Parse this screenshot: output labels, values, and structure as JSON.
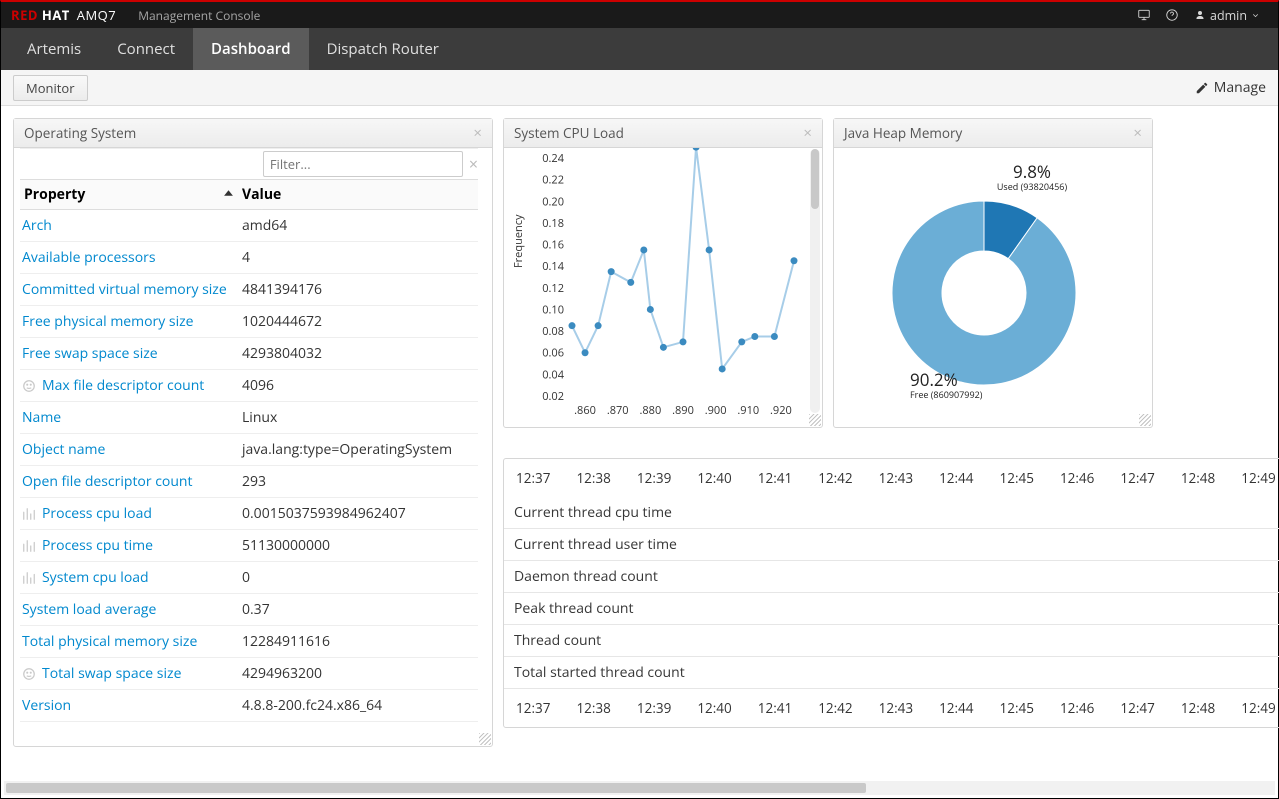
{
  "brand": {
    "red": "RED",
    "hat": "HAT",
    "amq": "AMQ7",
    "subtitle": "Management Console"
  },
  "user": {
    "name": "admin"
  },
  "nav": {
    "items": [
      "Artemis",
      "Connect",
      "Dashboard",
      "Dispatch Router"
    ],
    "active": "Dashboard"
  },
  "subbar": {
    "tab": "Monitor",
    "manage": "Manage"
  },
  "os": {
    "title": "Operating System",
    "filter_placeholder": "Filter...",
    "col1": "Property",
    "col2": "Value",
    "rows": [
      {
        "icon": null,
        "prop": "Arch",
        "val": "amd64"
      },
      {
        "icon": null,
        "prop": "Available processors",
        "val": "4"
      },
      {
        "icon": null,
        "prop": "Committed virtual memory size",
        "val": "4841394176"
      },
      {
        "icon": null,
        "prop": "Free physical memory size",
        "val": "1020444672"
      },
      {
        "icon": null,
        "prop": "Free swap space size",
        "val": "4293804032"
      },
      {
        "icon": "face",
        "prop": "Max file descriptor count",
        "val": "4096"
      },
      {
        "icon": null,
        "prop": "Name",
        "val": "Linux"
      },
      {
        "icon": null,
        "prop": "Object name",
        "val": "java.lang:type=OperatingSystem"
      },
      {
        "icon": null,
        "prop": "Open file descriptor count",
        "val": "293"
      },
      {
        "icon": "chart",
        "prop": "Process cpu load",
        "val": "0.0015037593984962407"
      },
      {
        "icon": "chart",
        "prop": "Process cpu time",
        "val": "51130000000"
      },
      {
        "icon": "chart",
        "prop": "System cpu load",
        "val": "0"
      },
      {
        "icon": null,
        "prop": "System load average",
        "val": "0.37"
      },
      {
        "icon": null,
        "prop": "Total physical memory size",
        "val": "12284911616"
      },
      {
        "icon": "face",
        "prop": "Total swap space size",
        "val": "4294963200"
      },
      {
        "icon": null,
        "prop": "Version",
        "val": "4.8.8-200.fc24.x86_64"
      }
    ]
  },
  "cpu": {
    "title": "System CPU Load"
  },
  "heap": {
    "title": "Java Heap Memory",
    "used_pct": "9.8%",
    "used_label": "Used (93820456)",
    "free_pct": "90.2%",
    "free_label": "Free (860907992)"
  },
  "threads": {
    "times": [
      "12:37",
      "12:38",
      "12:39",
      "12:40",
      "12:41",
      "12:42",
      "12:43",
      "12:44",
      "12:45",
      "12:46",
      "12:47",
      "12:48",
      "12:49"
    ],
    "rows": [
      "Current thread cpu time",
      "Current thread user time",
      "Daemon thread count",
      "Peak thread count",
      "Thread count",
      "Total started thread count"
    ]
  },
  "chart_data": [
    {
      "type": "line",
      "title": "System CPU Load",
      "ylabel": "Frequency",
      "x": [
        0.856,
        0.86,
        0.864,
        0.868,
        0.874,
        0.878,
        0.88,
        0.884,
        0.89,
        0.894,
        0.898,
        0.902,
        0.908,
        0.912,
        0.918,
        0.924
      ],
      "values": [
        0.085,
        0.06,
        0.085,
        0.135,
        0.125,
        0.155,
        0.1,
        0.065,
        0.07,
        0.25,
        0.155,
        0.045,
        0.07,
        0.075,
        0.075,
        0.145
      ],
      "xticks": [
        ".860",
        ".870",
        ".880",
        ".890",
        ".900",
        ".910",
        ".920"
      ],
      "ylim": [
        0.02,
        0.24
      ],
      "yticks": [
        0.02,
        0.04,
        0.06,
        0.08,
        0.1,
        0.12,
        0.14,
        0.16,
        0.18,
        0.2,
        0.22,
        0.24
      ]
    },
    {
      "type": "pie",
      "title": "Java Heap Memory",
      "series": [
        {
          "name": "Used",
          "value": 93820456,
          "pct": 9.8
        },
        {
          "name": "Free",
          "value": 860907992,
          "pct": 90.2
        }
      ]
    }
  ]
}
